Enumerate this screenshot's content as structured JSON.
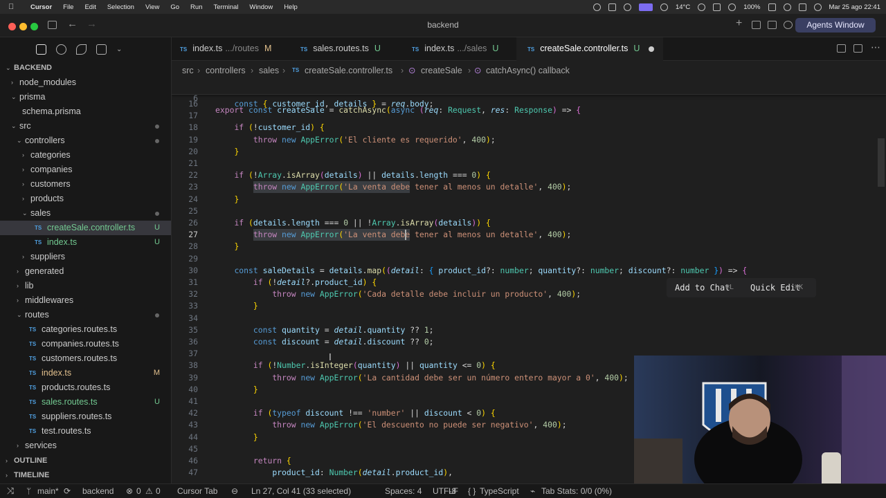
{
  "menubar": {
    "app": "Cursor",
    "items": [
      "File",
      "Edit",
      "Selection",
      "View",
      "Go",
      "Run",
      "Terminal",
      "Window",
      "Help"
    ],
    "temperature": "14°C",
    "battery": "100%",
    "datetime": "Mar 25 ago  22:41"
  },
  "window": {
    "title": "backend",
    "agents_button": "Agents Window"
  },
  "sidebar": {
    "root": "BACKEND",
    "tree": [
      {
        "label": "node_modules",
        "type": "folder",
        "open": false,
        "level": 1
      },
      {
        "label": "prisma",
        "type": "folder",
        "open": true,
        "level": 1
      },
      {
        "label": "schema.prisma",
        "type": "file",
        "level": 2
      },
      {
        "label": "src",
        "type": "folder",
        "open": true,
        "level": 1,
        "dot": true
      },
      {
        "label": "controllers",
        "type": "folder",
        "open": true,
        "level": 2,
        "dot": true
      },
      {
        "label": "categories",
        "type": "folder",
        "open": false,
        "level": 3
      },
      {
        "label": "companies",
        "type": "folder",
        "open": false,
        "level": 3
      },
      {
        "label": "customers",
        "type": "folder",
        "open": false,
        "level": 3
      },
      {
        "label": "products",
        "type": "folder",
        "open": false,
        "level": 3
      },
      {
        "label": "sales",
        "type": "folder",
        "open": true,
        "level": 3,
        "dot": true
      },
      {
        "label": "createSale.controller.ts",
        "type": "ts",
        "level": 4,
        "badge": "U",
        "selected": true
      },
      {
        "label": "index.ts",
        "type": "ts",
        "level": 4,
        "badge": "U"
      },
      {
        "label": "suppliers",
        "type": "folder",
        "open": false,
        "level": 3
      },
      {
        "label": "generated",
        "type": "folder",
        "open": false,
        "level": 2
      },
      {
        "label": "lib",
        "type": "folder",
        "open": false,
        "level": 2
      },
      {
        "label": "middlewares",
        "type": "folder",
        "open": false,
        "level": 2
      },
      {
        "label": "routes",
        "type": "folder",
        "open": true,
        "level": 2,
        "dot": true
      },
      {
        "label": "categories.routes.ts",
        "type": "ts",
        "level": 3
      },
      {
        "label": "companies.routes.ts",
        "type": "ts",
        "level": 3
      },
      {
        "label": "customers.routes.ts",
        "type": "ts",
        "level": 3
      },
      {
        "label": "index.ts",
        "type": "ts",
        "level": 3,
        "badge": "M"
      },
      {
        "label": "products.routes.ts",
        "type": "ts",
        "level": 3
      },
      {
        "label": "sales.routes.ts",
        "type": "ts",
        "level": 3,
        "badge": "U"
      },
      {
        "label": "suppliers.routes.ts",
        "type": "ts",
        "level": 3
      },
      {
        "label": "test.routes.ts",
        "type": "ts",
        "level": 3
      },
      {
        "label": "services",
        "type": "folder",
        "open": false,
        "level": 2
      }
    ],
    "outline": "OUTLINE",
    "timeline": "TIMELINE"
  },
  "tabs": [
    {
      "icon": "TS",
      "label": "index.ts",
      "desc": ".../routes",
      "status": "M"
    },
    {
      "icon": "TS",
      "label": "sales.routes.ts",
      "desc": "",
      "status": "U"
    },
    {
      "icon": "TS",
      "label": "index.ts",
      "desc": ".../sales",
      "status": "U"
    },
    {
      "icon": "TS",
      "label": "createSale.controller.ts",
      "desc": "",
      "status": "U",
      "active": true
    }
  ],
  "breadcrumb": [
    "src",
    "controllers",
    "sales",
    "createSale.controller.ts",
    "createSale",
    "catchAsync() callback"
  ],
  "editor": {
    "sticky_line": {
      "num": "6",
      "code": "export const createSale = catchAsync(async (req: Request, res: Response) => {"
    },
    "lines": [
      {
        "num": "16",
        "code": "    const { customer_id, details } = req.body;"
      },
      {
        "num": "17",
        "code": ""
      },
      {
        "num": "18",
        "code": "    if (!customer_id) {"
      },
      {
        "num": "19",
        "code": "        throw new AppError('El cliente es requerido', 400);"
      },
      {
        "num": "20",
        "code": "    }"
      },
      {
        "num": "21",
        "code": ""
      },
      {
        "num": "22",
        "code": "    if (!Array.isArray(details) || details.length === 0) {"
      },
      {
        "num": "23",
        "code": "        throw new AppError('La venta debe tener al menos un detalle', 400);"
      },
      {
        "num": "24",
        "code": "    }"
      },
      {
        "num": "25",
        "code": ""
      },
      {
        "num": "26",
        "code": "    if (details.length === 0 || !Array.isArray(details)) {"
      },
      {
        "num": "27",
        "code": "        throw new AppError('La venta debe tener al menos un detalle', 400);"
      },
      {
        "num": "28",
        "code": "    }"
      },
      {
        "num": "29",
        "code": ""
      },
      {
        "num": "30",
        "code": "    const saleDetails = details.map((detail: { product_id?: number; quantity?: number; discount?: number }) => {"
      },
      {
        "num": "31",
        "code": "        if (!detail?.product_id) {"
      },
      {
        "num": "32",
        "code": "            throw new AppError('Cada detalle debe incluir un producto', 400);"
      },
      {
        "num": "33",
        "code": "        }"
      },
      {
        "num": "34",
        "code": ""
      },
      {
        "num": "35",
        "code": "        const quantity = detail.quantity ?? 1;"
      },
      {
        "num": "36",
        "code": "        const discount = detail.discount ?? 0;"
      },
      {
        "num": "37",
        "code": ""
      },
      {
        "num": "38",
        "code": "        if (!Number.isInteger(quantity) || quantity <= 0) {"
      },
      {
        "num": "39",
        "code": "            throw new AppError('La cantidad debe ser un número entero mayor a 0', 400);"
      },
      {
        "num": "40",
        "code": "        }"
      },
      {
        "num": "41",
        "code": ""
      },
      {
        "num": "42",
        "code": "        if (typeof discount !== 'number' || discount < 0) {"
      },
      {
        "num": "43",
        "code": "            throw new AppError('El descuento no puede ser negativo', 400);"
      },
      {
        "num": "44",
        "code": "        }"
      },
      {
        "num": "45",
        "code": ""
      },
      {
        "num": "46",
        "code": "        return {"
      },
      {
        "num": "47",
        "code": "            product_id: Number(detail.product_id),"
      }
    ],
    "current_line": "27",
    "inline_menu": {
      "add": "Add to Chat",
      "add_key": "⌘L",
      "edit": "Quick Edit",
      "edit_key": "⌘K"
    }
  },
  "statusbar": {
    "branch": "main*",
    "project": "backend",
    "errors": "0",
    "warnings": "0",
    "cursor_tab": "Cursor Tab",
    "position": "Ln 27, Col 41 (33 selected)",
    "spaces": "Spaces: 4",
    "encoding": "UTF-8",
    "eol": "LF",
    "language": "TypeScript",
    "tab_stats": "Tab Stats: 0/0 (0%)"
  },
  "colors": {
    "accent": "#3a3f62",
    "ts_icon": "#4f9fe0",
    "modified": "#e2c08d",
    "untracked": "#73c991"
  }
}
